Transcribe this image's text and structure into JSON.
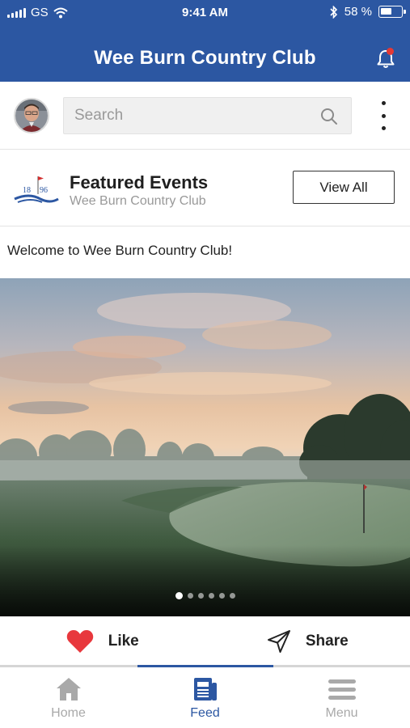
{
  "status_bar": {
    "carrier": "GS",
    "time": "9:41 AM",
    "battery_percent": "58 %",
    "battery_level": 0.58
  },
  "header": {
    "title": "Wee Burn Country Club",
    "notification_badge": true
  },
  "search": {
    "placeholder": "Search",
    "value": ""
  },
  "featured": {
    "title": "Featured Events",
    "subtitle": "Wee Burn Country Club",
    "logo_text": "18 96",
    "view_all_label": "View All"
  },
  "post": {
    "text": "Welcome to Wee Burn Country Club!",
    "image_subject": "misty golf course at sunrise",
    "carousel_total": 6,
    "carousel_active": 1
  },
  "actions": {
    "like_label": "Like",
    "share_label": "Share"
  },
  "tabs": [
    {
      "label": "Home",
      "icon": "home-icon",
      "active": false
    },
    {
      "label": "Feed",
      "icon": "feed-icon",
      "active": true
    },
    {
      "label": "Menu",
      "icon": "menu-icon",
      "active": false
    }
  ],
  "colors": {
    "brand": "#2c57a2",
    "like": "#e8383d",
    "badge": "#e53935",
    "inactive_tab": "#a9a9a9"
  }
}
